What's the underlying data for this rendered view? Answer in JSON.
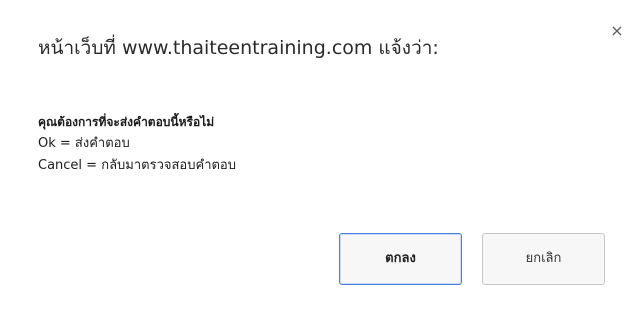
{
  "dialog": {
    "title": "หน้าเว็บที่ www.thaiteentraining.com แจ้งว่า:",
    "close_symbol": "×",
    "close_icon": "close-icon",
    "message_lines": [
      "คุณต้องการที่จะส่งคำตอบนี้หรือไม่",
      "Ok = ส่งคำตอบ",
      "Cancel = กลับมาตรวจสอบคำตอบ"
    ],
    "ok_label": "ตกลง",
    "cancel_label": "ยกเลิก"
  },
  "colors": {
    "background": "#ffffff",
    "ok_border": "#4a7fe0",
    "button_background": "#f7f7f7",
    "cancel_border": "#c7c7c7"
  }
}
